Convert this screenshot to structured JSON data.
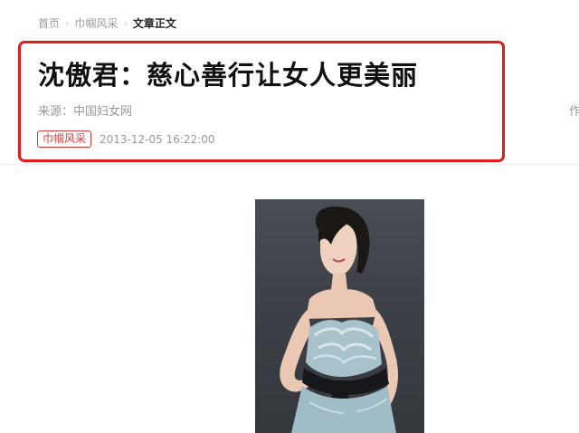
{
  "breadcrumb": {
    "home": "首页",
    "category": "巾帼风采",
    "current": "文章正文"
  },
  "article": {
    "title": "沈傲君：慈心善行让女人更美丽",
    "source": "来源：中国妇女网",
    "author_fragment": "作",
    "tag": "巾帼风采",
    "timestamp": "2013-12-05 16:22:00"
  },
  "colors": {
    "highlight_border": "#e31b1b",
    "tag": "#d63a3a",
    "muted_text": "#999999",
    "title_text": "#111111"
  }
}
